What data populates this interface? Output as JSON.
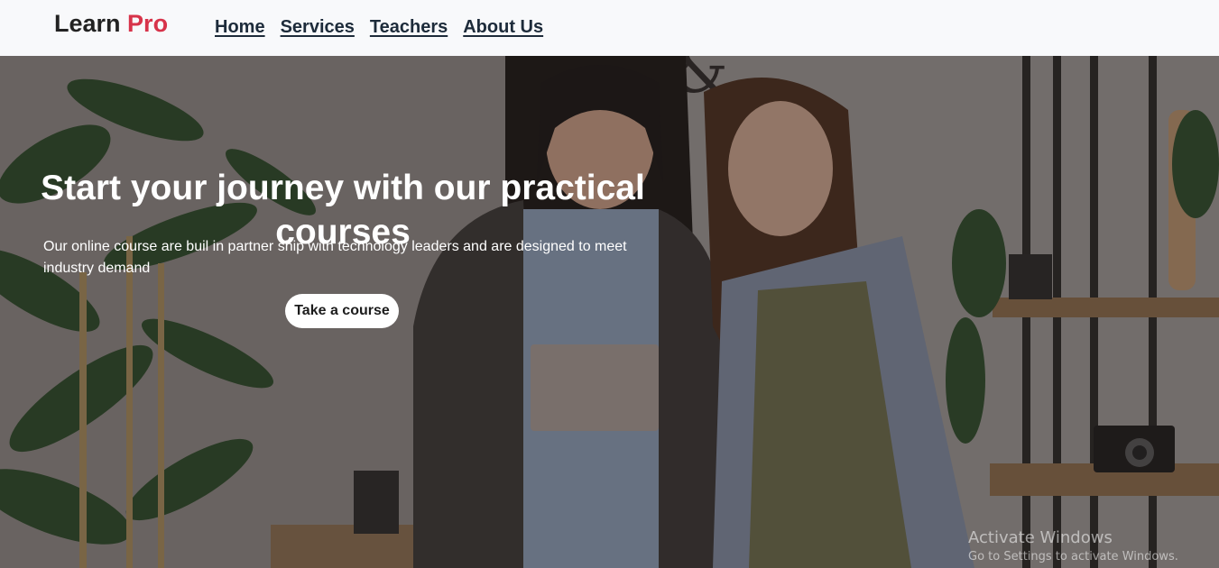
{
  "brand": {
    "name": "Learn",
    "accent": "Pro"
  },
  "nav": {
    "items": [
      {
        "label": "Home"
      },
      {
        "label": "Services"
      },
      {
        "label": "Teachers"
      },
      {
        "label": "About Us"
      }
    ]
  },
  "hero": {
    "title_line1": "Start your journey with our practical",
    "title_line2": "courses",
    "subtitle": "Our online course are buil in partner ship with technology leaders and are designed to meet industry demand",
    "cta_label": "Take a course"
  },
  "watermark": {
    "line1": "Activate Windows",
    "line2": "Go to Settings to activate Windows."
  },
  "colors": {
    "accent": "#d7334a",
    "nav_text": "#1d2b3a",
    "navbar_bg": "#f8f9fb"
  }
}
